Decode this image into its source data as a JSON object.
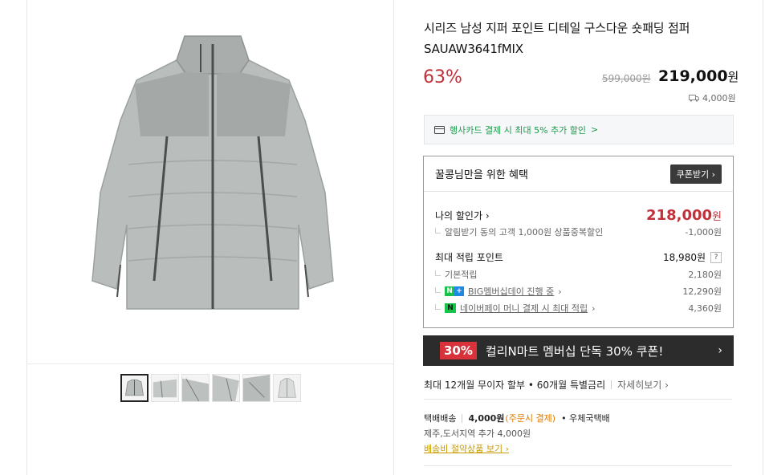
{
  "product": {
    "title": "시리즈 남성 지퍼 포인트 디테일 구스다운 숏패딩 점퍼 SAUAW3641fMIX",
    "discount_rate": "63%",
    "original_price": "599,000원",
    "sale_price": "219,000",
    "sale_price_unit": "원",
    "shipping_fee": "4,000원",
    "thumbnail_count": 6
  },
  "card_promo": {
    "text": "행사카드 결제 시 최대 5% 추가 할인",
    "chevron": ">"
  },
  "benefit": {
    "title": "꿀콩님만을 위한 혜택",
    "coupon_button": "쿠폰받기",
    "my_price_label": "나의 할인가",
    "my_price_value": "218,000",
    "my_price_unit": "원",
    "alarm_label": "알림받기 동의 고객 1,000원 상품중복할인",
    "alarm_value": "-1,000원",
    "points_label": "최대 적립 포인트",
    "points_value": "18,980원",
    "points_help": "?",
    "base_label": "기본적립",
    "base_value": "2,180원",
    "big_label": "BIG멤버십데이 진행 중",
    "big_value": "12,290원",
    "naverpay_label": "네이버페이 머니 결제 시 최대 적립",
    "naverpay_value": "4,360원",
    "badge_n": "N",
    "badge_plus": "+",
    "badge_np": "N"
  },
  "banner": {
    "percent": "30%",
    "text": "컬리N마트 멤버십 단독 30% 쿠폰!",
    "chevron": "›"
  },
  "installment": {
    "text": "최대 12개월 무이자 할부 • 60개월 특별금리",
    "more": "자세히보기"
  },
  "delivery": {
    "type": "택배배송",
    "fee": "4,000원",
    "note": "(주문시 결제)",
    "carrier": "• 우체국택배",
    "extra": "제주,도서지역 추가 4,000원",
    "saving_link": "배송비 절약상품 보기"
  },
  "colors": {
    "accent_red": "#c0313a",
    "green": "#1a9b4b",
    "banner_bg": "#2c2c2c",
    "jacket": "#b9bebd"
  }
}
